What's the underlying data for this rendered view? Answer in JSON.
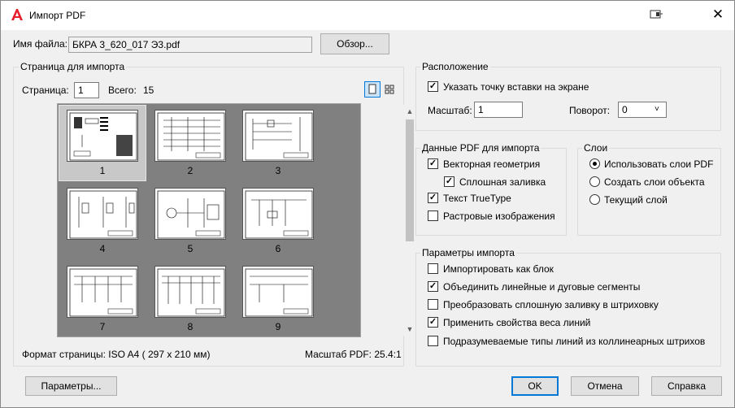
{
  "window": {
    "title": "Импорт PDF"
  },
  "file": {
    "label": "Имя файла:",
    "value": "БКРА 3_620_017 Э3.pdf",
    "browse_label": "Обзор..."
  },
  "page_group": {
    "title": "Страница для импорта",
    "page_label": "Страница:",
    "page_value": "1",
    "total_label": "Всего:",
    "total_value": "15",
    "thumbnails": [
      "1",
      "2",
      "3",
      "4",
      "5",
      "6",
      "7",
      "8",
      "9"
    ],
    "format_text": "Формат страницы: ISO A4 ( 297 x  210 мм)",
    "scale_text": "Масштаб PDF:  25.4:1"
  },
  "location": {
    "title": "Расположение",
    "insert_point_label": "Указать точку вставки на экране",
    "insert_point_checked": true,
    "scale_label": "Масштаб:",
    "scale_value": "1",
    "rotation_label": "Поворот:",
    "rotation_value": "0"
  },
  "pdf_data": {
    "title": "Данные PDF для импорта",
    "vector_label": "Векторная геометрия",
    "vector_checked": true,
    "solid_fill_label": "Сплошная заливка",
    "solid_fill_checked": true,
    "truetype_label": "Текст TrueType",
    "truetype_checked": true,
    "raster_label": "Растровые изображения",
    "raster_checked": false
  },
  "layers": {
    "title": "Слои",
    "use_pdf_layers_label": "Использовать слои PDF",
    "create_object_layers_label": "Создать слои объекта",
    "current_layer_label": "Текущий слой",
    "selected": "use_pdf_layers"
  },
  "import_params": {
    "title": "Параметры импорта",
    "as_block_label": "Импортировать как блок",
    "as_block_checked": false,
    "join_segments_label": "Объединить линейные и дуговые сегменты",
    "join_segments_checked": true,
    "convert_fill_label": "Преобразовать сплошную заливку в штриховку",
    "convert_fill_checked": false,
    "lineweight_label": "Применить свойства веса линий",
    "lineweight_checked": true,
    "linetypes_label": "Подразумеваемые типы линий из коллинеарных штрихов",
    "linetypes_checked": false
  },
  "buttons": {
    "settings": "Параметры...",
    "ok": "OK",
    "cancel": "Отмена",
    "help": "Справка"
  },
  "icons": {
    "app": "autocad-logo-icon",
    "pin": "window-pin-icon",
    "close": "close-icon"
  },
  "colors": {
    "accent": "#0078d7",
    "logo": "#e51f2b",
    "viewer_bg": "#808080"
  }
}
